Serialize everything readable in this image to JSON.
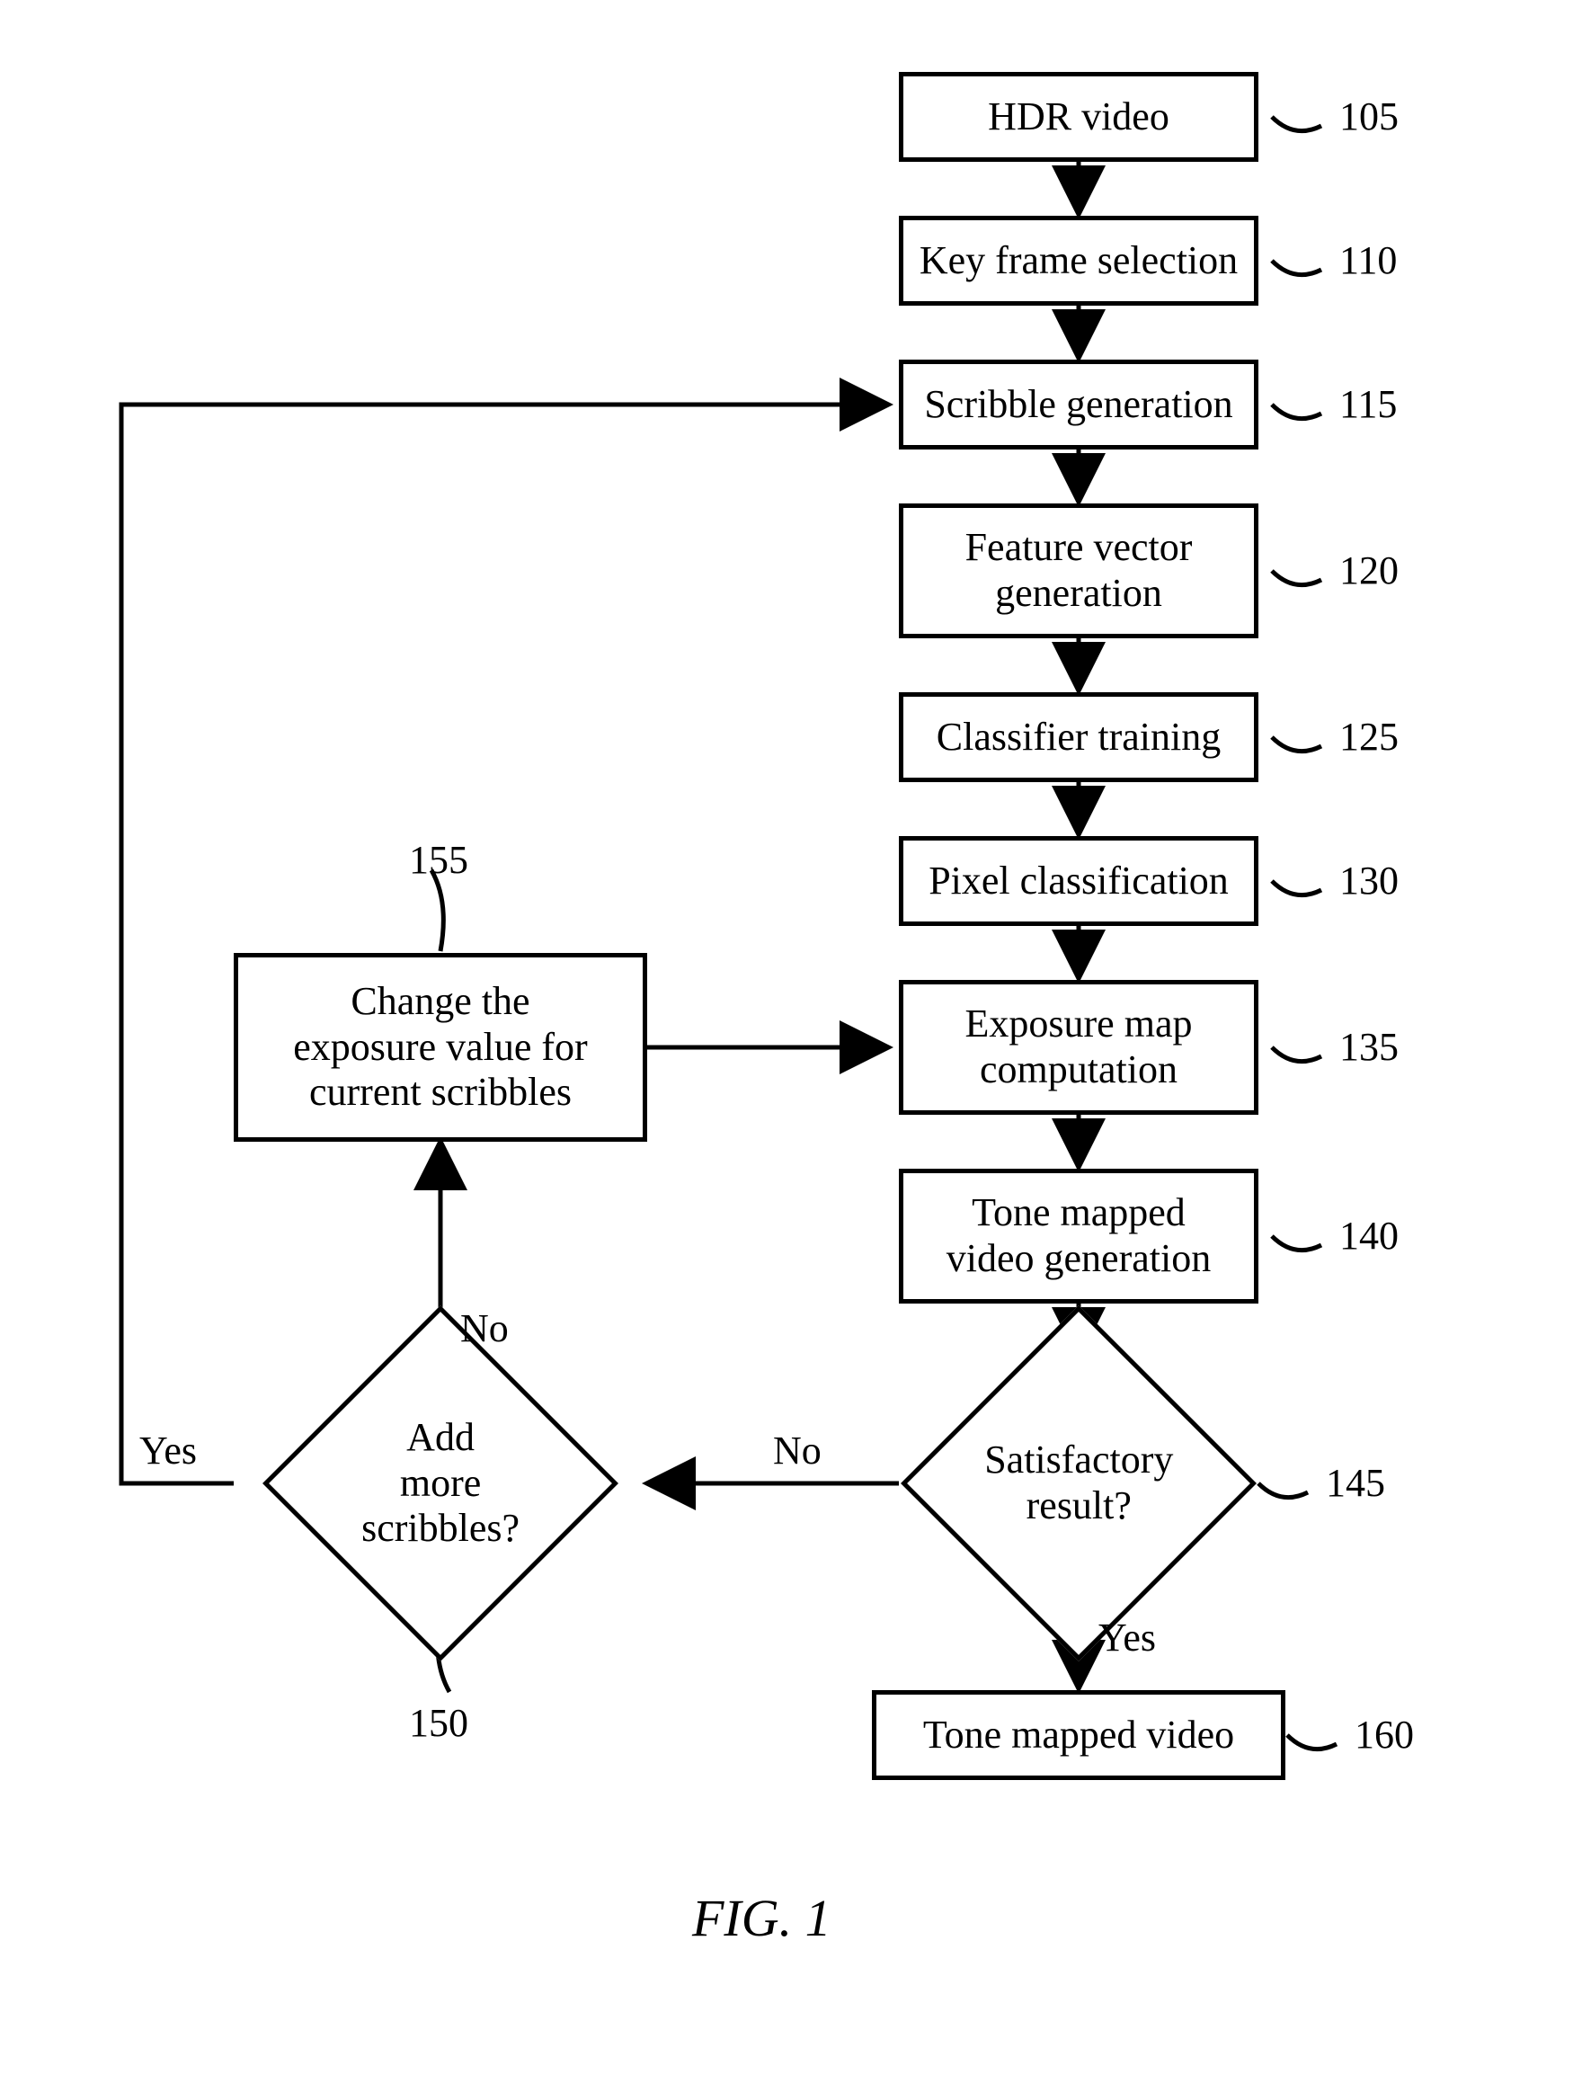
{
  "chart_data": {
    "type": "flowchart",
    "title": "FIG. 1",
    "nodes": [
      {
        "id": "105",
        "label": "HDR video",
        "shape": "rect"
      },
      {
        "id": "110",
        "label": "Key frame selection",
        "shape": "rect"
      },
      {
        "id": "115",
        "label": "Scribble generation",
        "shape": "rect"
      },
      {
        "id": "120",
        "label": "Feature vector\ngeneration",
        "shape": "rect"
      },
      {
        "id": "125",
        "label": "Classifier training",
        "shape": "rect"
      },
      {
        "id": "130",
        "label": "Pixel classification",
        "shape": "rect"
      },
      {
        "id": "135",
        "label": "Exposure map\ncomputation",
        "shape": "rect"
      },
      {
        "id": "140",
        "label": "Tone mapped\nvideo generation",
        "shape": "rect"
      },
      {
        "id": "145",
        "label": "Satisfactory\nresult?",
        "shape": "diamond"
      },
      {
        "id": "150",
        "label": "Add\nmore scribbles?",
        "shape": "diamond"
      },
      {
        "id": "155",
        "label": "Change the\nexposure value for\ncurrent scribbles",
        "shape": "rect"
      },
      {
        "id": "160",
        "label": "Tone mapped video",
        "shape": "rect"
      }
    ],
    "edges": [
      {
        "from": "105",
        "to": "110"
      },
      {
        "from": "110",
        "to": "115"
      },
      {
        "from": "115",
        "to": "120"
      },
      {
        "from": "120",
        "to": "125"
      },
      {
        "from": "125",
        "to": "130"
      },
      {
        "from": "130",
        "to": "135"
      },
      {
        "from": "135",
        "to": "140"
      },
      {
        "from": "140",
        "to": "145"
      },
      {
        "from": "145",
        "to": "160",
        "label": "Yes"
      },
      {
        "from": "145",
        "to": "150",
        "label": "No"
      },
      {
        "from": "150",
        "to": "155",
        "label": "No"
      },
      {
        "from": "150",
        "to": "115",
        "label": "Yes",
        "note": "loop back"
      },
      {
        "from": "155",
        "to": "135"
      }
    ]
  },
  "n105": {
    "label": "HDR video",
    "ref": "105"
  },
  "n110": {
    "label": "Key frame selection",
    "ref": "110"
  },
  "n115": {
    "label": "Scribble generation",
    "ref": "115"
  },
  "n120": {
    "label": "Feature vector\ngeneration",
    "ref": "120"
  },
  "n125": {
    "label": "Classifier training",
    "ref": "125"
  },
  "n130": {
    "label": "Pixel classification",
    "ref": "130"
  },
  "n135": {
    "label": "Exposure map\ncomputation",
    "ref": "135"
  },
  "n140": {
    "label": "Tone mapped\nvideo generation",
    "ref": "140"
  },
  "n145": {
    "label": "Satisfactory\nresult?",
    "ref": "145"
  },
  "n150": {
    "label": "Add\nmore scribbles?",
    "ref": "150"
  },
  "n155": {
    "label": "Change the\nexposure value for\ncurrent scribbles",
    "ref": "155"
  },
  "n160": {
    "label": "Tone mapped video",
    "ref": "160"
  },
  "edge_labels": {
    "d145_yes": "Yes",
    "d145_no": "No",
    "d150_yes": "Yes",
    "d150_no": "No"
  },
  "caption": "FIG. 1"
}
